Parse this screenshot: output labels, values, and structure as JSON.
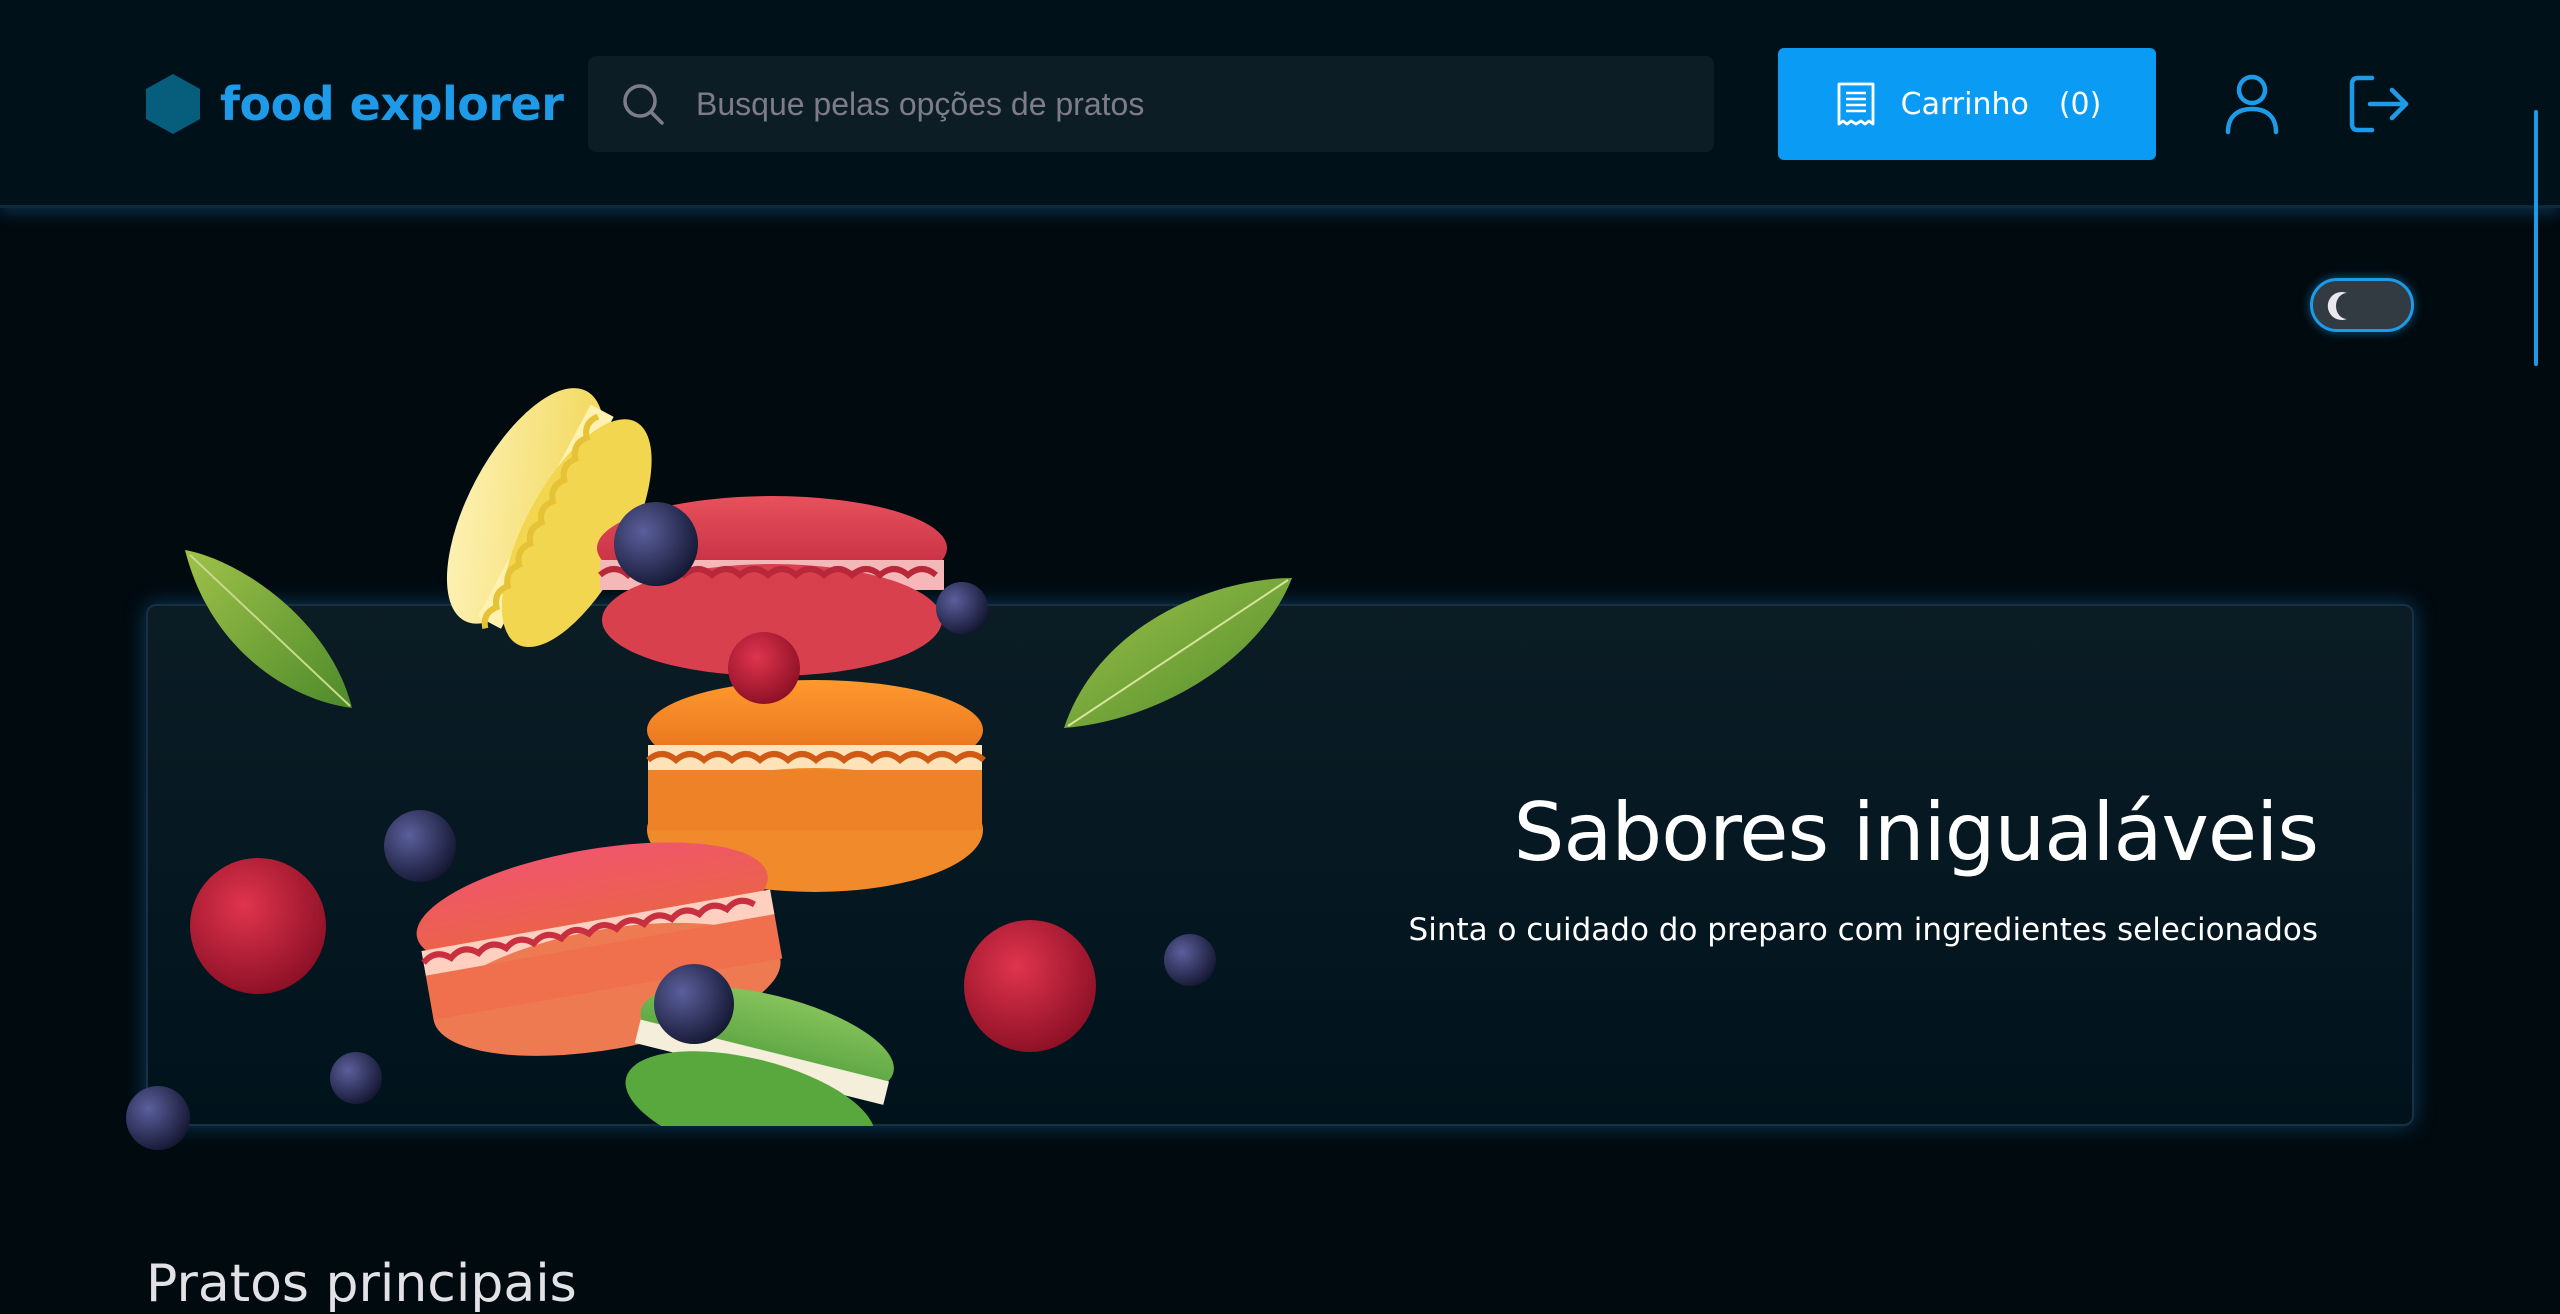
{
  "header": {
    "logo_text": "food explorer",
    "search": {
      "placeholder": "Busque pelas opções de pratos"
    },
    "cart": {
      "label": "Carrinho",
      "count": "(0)"
    }
  },
  "theme_toggle": {
    "mode": "dark"
  },
  "banner": {
    "title": "Sabores inigualáveis",
    "subtitle": "Sinta o cuidado do preparo com ingredientes selecionados"
  },
  "section": {
    "title": "Pratos principais"
  },
  "colors": {
    "accent": "#0a9cf5",
    "logo": "#1e9be8",
    "background": "#000a0f",
    "header_bg": "#00111a"
  }
}
